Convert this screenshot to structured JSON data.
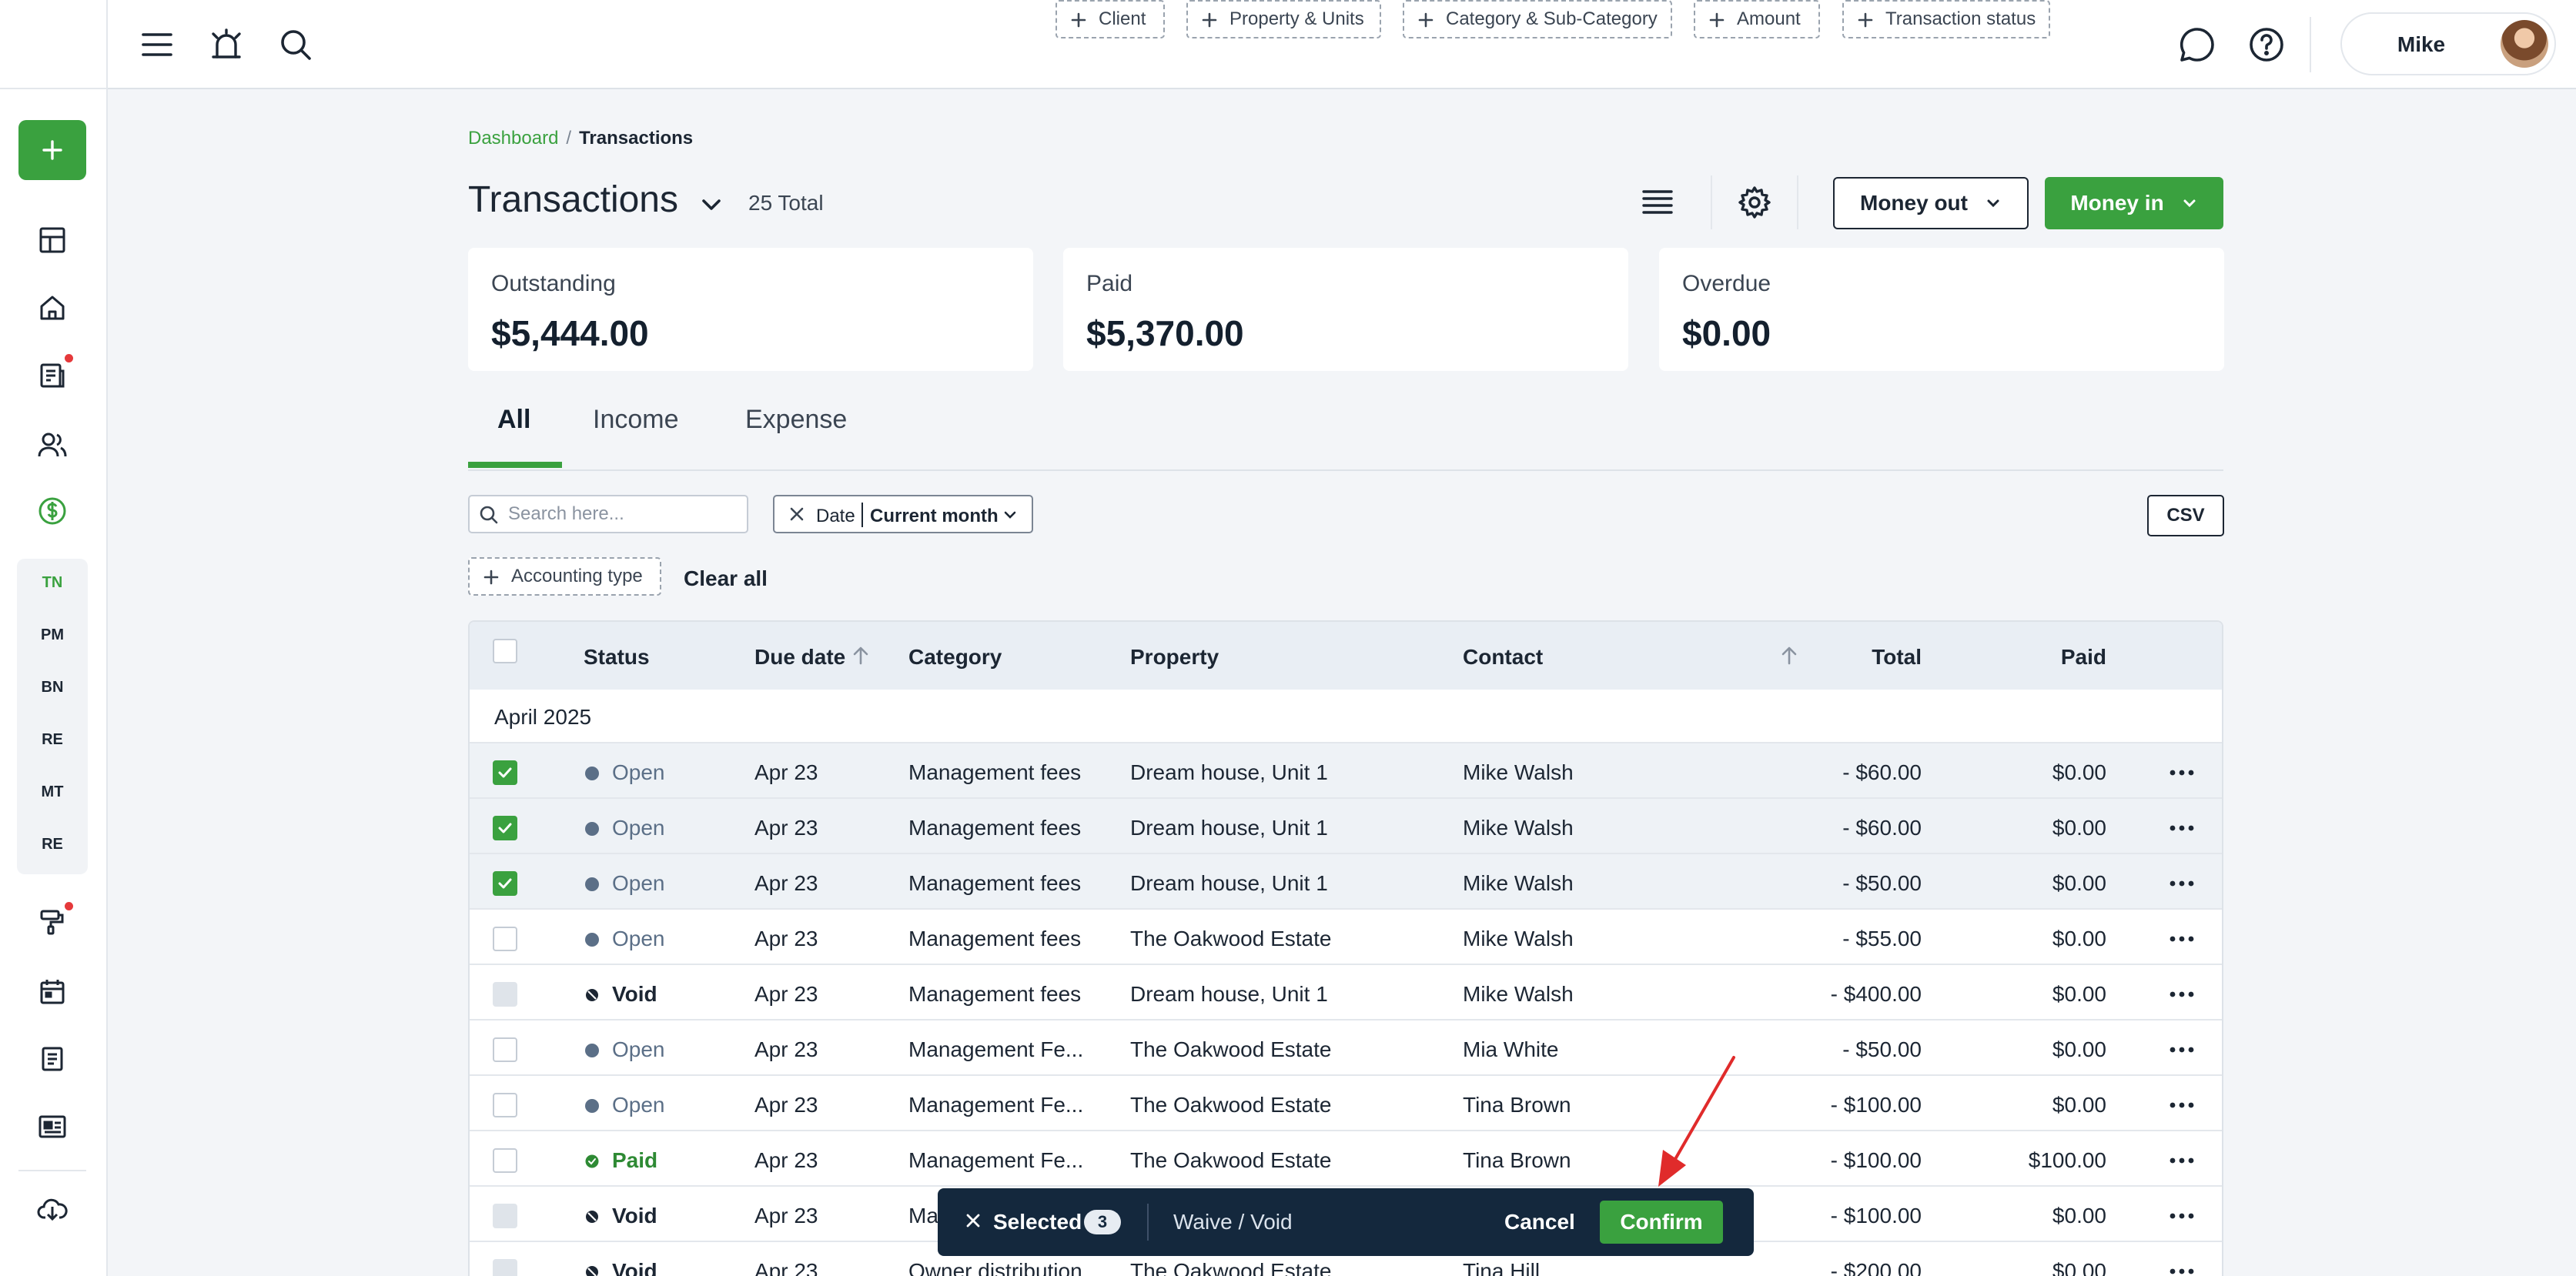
{
  "colors": {
    "accent": "#3aa13f",
    "dark": "#14283d",
    "notification_dot": "#e5393b",
    "status_open": "#5b6f87",
    "status_paid": "#2e8a34",
    "annotation_arrow": "#e02b2b"
  },
  "sidebar": {
    "add_icon": "plus-icon",
    "items": [
      {
        "icon": "dashboard-grid-icon"
      },
      {
        "icon": "home-icon"
      },
      {
        "icon": "document-list-icon",
        "notification": true
      },
      {
        "icon": "people-icon"
      },
      {
        "icon": "dollar-circle-icon",
        "active": true
      },
      {
        "icon": "paint-roller-icon",
        "notification": true
      },
      {
        "icon": "calendar-icon"
      },
      {
        "icon": "notes-icon"
      },
      {
        "icon": "id-card-icon"
      },
      {
        "icon": "cloud-download-icon"
      }
    ],
    "abbreviations": [
      "TN",
      "PM",
      "BN",
      "RE",
      "MT",
      "RE"
    ]
  },
  "topbar": {
    "icons": [
      "hamburger-menu-icon",
      "alarm-bell-icon",
      "search-icon",
      "chat-bubble-icon",
      "help-icon"
    ],
    "user_name": "Mike"
  },
  "breadcrumb": {
    "parent": "Dashboard",
    "separator": "/",
    "current": "Transactions"
  },
  "header": {
    "title": "Transactions",
    "total": "25 Total",
    "money_out": "Money out",
    "money_in": "Money in"
  },
  "summary": [
    {
      "label": "Outstanding",
      "value": "$5,444.00"
    },
    {
      "label": "Paid",
      "value": "$5,370.00"
    },
    {
      "label": "Overdue",
      "value": "$0.00"
    }
  ],
  "tabs": [
    "All",
    "Income",
    "Expense"
  ],
  "active_tab": "All",
  "filters": {
    "search_placeholder": "Search here...",
    "date_label": "Date",
    "date_value": "Current month",
    "chips": [
      "Client",
      "Property & Units",
      "Category & Sub-Category",
      "Amount",
      "Transaction status",
      "Accounting type"
    ],
    "csv": "CSV",
    "clear_all": "Clear all"
  },
  "table": {
    "columns": [
      "Status",
      "Due date",
      "Category",
      "Property",
      "Contact",
      "Total",
      "Paid"
    ],
    "group": "April 2025",
    "rows": [
      {
        "selected": true,
        "status": "Open",
        "due": "Apr 23",
        "category": "Management fees",
        "property": "Dream house, Unit 1",
        "contact": "Mike Walsh",
        "total": "- $60.00",
        "paid": "$0.00"
      },
      {
        "selected": true,
        "status": "Open",
        "due": "Apr 23",
        "category": "Management fees",
        "property": "Dream house, Unit 1",
        "contact": "Mike Walsh",
        "total": "- $60.00",
        "paid": "$0.00"
      },
      {
        "selected": true,
        "status": "Open",
        "due": "Apr 23",
        "category": "Management fees",
        "property": "Dream house, Unit 1",
        "contact": "Mike Walsh",
        "total": "- $50.00",
        "paid": "$0.00"
      },
      {
        "selected": false,
        "status": "Open",
        "due": "Apr 23",
        "category": "Management fees",
        "property": "The Oakwood Estate",
        "contact": "Mike Walsh",
        "total": "- $55.00",
        "paid": "$0.00"
      },
      {
        "selected": false,
        "status": "Void",
        "due": "Apr 23",
        "category": "Management fees",
        "property": "Dream house, Unit 1",
        "contact": "Mike Walsh",
        "total": "- $400.00",
        "paid": "$0.00"
      },
      {
        "selected": false,
        "status": "Open",
        "due": "Apr 23",
        "category": "Management Fe...",
        "property": "The Oakwood Estate",
        "contact": "Mia White",
        "total": "- $50.00",
        "paid": "$0.00"
      },
      {
        "selected": false,
        "status": "Open",
        "due": "Apr 23",
        "category": "Management Fe...",
        "property": "The Oakwood Estate",
        "contact": "Tina Brown",
        "total": "- $100.00",
        "paid": "$0.00"
      },
      {
        "selected": false,
        "status": "Paid",
        "due": "Apr 23",
        "category": "Management Fe...",
        "property": "The Oakwood Estate",
        "contact": "Tina Brown",
        "total": "- $100.00",
        "paid": "$100.00"
      },
      {
        "selected": false,
        "status": "Void",
        "due": "Apr 23",
        "category": "Ma",
        "property": "",
        "contact": "",
        "total": "- $100.00",
        "paid": "$0.00"
      },
      {
        "selected": false,
        "status": "Void",
        "due": "Apr 23",
        "category": "Owner distribution",
        "property": "The Oakwood Estate",
        "contact": "Tina Hill",
        "total": "- $200.00",
        "paid": "$0.00"
      }
    ]
  },
  "bulk_bar": {
    "selected_label": "Selected",
    "count": "3",
    "action": "Waive / Void",
    "cancel": "Cancel",
    "confirm": "Confirm"
  }
}
